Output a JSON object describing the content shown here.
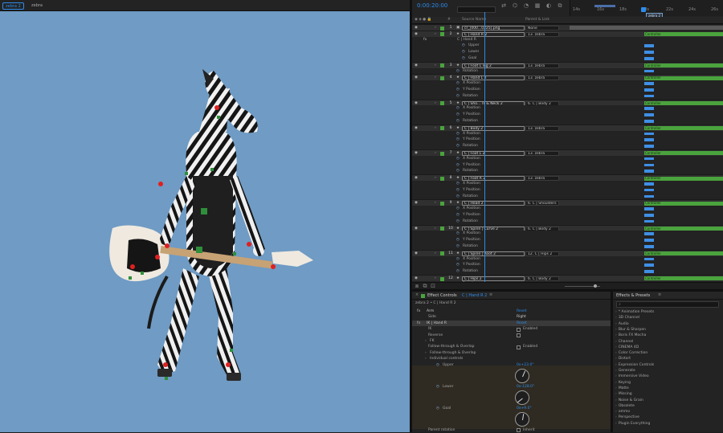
{
  "composition": {
    "tabs": [
      {
        "label": "zebra 2"
      },
      {
        "label": "zebra"
      }
    ]
  },
  "timeline": {
    "timecode": "0:00:20:00",
    "ruler_labels": [
      "14s",
      "16s",
      "18s",
      "20s",
      "22s",
      "24s",
      "26s"
    ],
    "end_marker": "zebra 2",
    "columns": {
      "source": "Source Name",
      "parent": "Parent & Link"
    },
    "layers": [
      {
        "num": "1",
        "source": "cr_[000...0225].png",
        "parent": "None",
        "bar": "grey"
      },
      {
        "num": "2",
        "source": "C | Hand R 2",
        "parent": "13. zebra",
        "bar": "green",
        "track": "Controller"
      },
      {
        "fx": true,
        "name": "C | Hand R"
      },
      {
        "prop": "Upper",
        "indent": 2
      },
      {
        "prop": "Lower",
        "indent": 2
      },
      {
        "prop": "Goal",
        "indent": 2
      },
      {
        "num": "3",
        "source": "C | Foot L ing 2",
        "parent": "13. zebra",
        "bar": "green",
        "track": "Controller"
      },
      {
        "prop": "Rotation",
        "indent": 1
      },
      {
        "num": "4",
        "source": "C | Hand L 2",
        "parent": "13. zebra",
        "bar": "green",
        "track": "Controller"
      },
      {
        "prop": "X Position",
        "indent": 1
      },
      {
        "prop": "Y Position",
        "indent": 1
      },
      {
        "prop": "Rotation",
        "indent": 1
      },
      {
        "num": "5",
        "source": "C | Sho... rs & Neck 2",
        "parent": "6. C | Body 2",
        "bar": "green",
        "track": "Controller"
      },
      {
        "prop": "X Position",
        "indent": 1
      },
      {
        "prop": "Y Position",
        "indent": 1
      },
      {
        "prop": "Rotation",
        "indent": 1
      },
      {
        "num": "6",
        "source": "C | Body 2",
        "parent": "13. zebra",
        "bar": "green",
        "track": "Controller"
      },
      {
        "prop": "X Position",
        "indent": 1
      },
      {
        "prop": "Y Position",
        "indent": 1
      },
      {
        "prop": "Rotation",
        "indent": 1
      },
      {
        "num": "7",
        "source": "C | Foot L 2",
        "parent": "13. zebra",
        "bar": "green",
        "track": "Controller"
      },
      {
        "prop": "X Position",
        "indent": 1
      },
      {
        "prop": "Y Position",
        "indent": 1
      },
      {
        "prop": "Rotation",
        "indent": 1
      },
      {
        "num": "8",
        "source": "C | Foot R 2",
        "parent": "13. zebra",
        "bar": "green",
        "track": "Controller"
      },
      {
        "prop": "X Position",
        "indent": 1
      },
      {
        "prop": "Y Position",
        "indent": 1
      },
      {
        "prop": "Rotation",
        "indent": 1
      },
      {
        "num": "9",
        "source": "C | Head 2",
        "parent": "6. C | Shoulders",
        "bar": "green",
        "track": "Controller"
      },
      {
        "prop": "X Position",
        "indent": 1
      },
      {
        "prop": "Y Position",
        "indent": 1
      },
      {
        "prop": "Rotation",
        "indent": 1
      },
      {
        "num": "10",
        "source": "C | Spine | Curve 2",
        "parent": "6. C | Body 2",
        "bar": "green",
        "track": "Controller"
      },
      {
        "prop": "X Position",
        "indent": 1
      },
      {
        "prop": "Y Position",
        "indent": 1
      },
      {
        "prop": "Rotation",
        "indent": 1
      },
      {
        "num": "11",
        "source": "C | Spine | Root 2",
        "parent": "12. C | Hips 2",
        "bar": "green",
        "track": "Controller"
      },
      {
        "prop": "X Position",
        "indent": 1
      },
      {
        "prop": "Y Position",
        "indent": 1
      },
      {
        "prop": "Rotation",
        "indent": 1
      },
      {
        "num": "12",
        "source": "C | Hips 2",
        "parent": "6. C | Body 2",
        "bar": "green",
        "track": "Controller"
      },
      {
        "prop": "Rotation",
        "indent": 1
      }
    ]
  },
  "effect_controls": {
    "title": "Effect Controls",
    "layer": "C | Hand R 2",
    "breadcrumb": "zebra 2 • C | Hand R 2",
    "rows": [
      {
        "kind": "fx",
        "label": "Arm",
        "value": "Reset"
      },
      {
        "kind": "prop",
        "label": "Side",
        "value": "Right"
      },
      {
        "kind": "fx",
        "label": "IK | Hand R",
        "value": "Reset",
        "selected": true
      },
      {
        "kind": "check",
        "label": "IK",
        "value": "Enabled"
      },
      {
        "kind": "check",
        "label": "Reverse",
        "value": ""
      },
      {
        "kind": "group",
        "label": "FK"
      },
      {
        "kind": "check",
        "label": "Follow-through & Overlap",
        "value": "Enabled"
      },
      {
        "kind": "group",
        "label": "Follow-through & Overlap"
      },
      {
        "kind": "group",
        "label": "Individual controls"
      },
      {
        "kind": "dial",
        "label": "Upper",
        "value": "0x+23.0°",
        "angle": 23
      },
      {
        "kind": "dial",
        "label": "Lower",
        "value": "0x-128.0°",
        "angle": -128
      },
      {
        "kind": "dial",
        "label": "Goal",
        "value": "0x+9.0°",
        "angle": 9
      },
      {
        "kind": "check",
        "label": "Parent rotation",
        "value": "Inherit"
      }
    ]
  },
  "effects_presets": {
    "title": "Effects & Presets",
    "search_placeholder": "",
    "items": [
      "* Animation Presets",
      "3D Channel",
      "Audio",
      "Blur & Sharpen",
      "Boris FX Mocha",
      "Channel",
      "CINEMA 4D",
      "Color Correction",
      "Distort",
      "Expression Controls",
      "Generate",
      "Immersive Video",
      "Keying",
      "Matte",
      "Missing",
      "Noise & Grain",
      "Obsolete",
      "ammo",
      "Perspective",
      "Plugin Everything"
    ]
  },
  "colors": {
    "accent": "#2d8ceb",
    "label_green": "#4aa33d",
    "comp_bg": "#6f9bc4"
  }
}
